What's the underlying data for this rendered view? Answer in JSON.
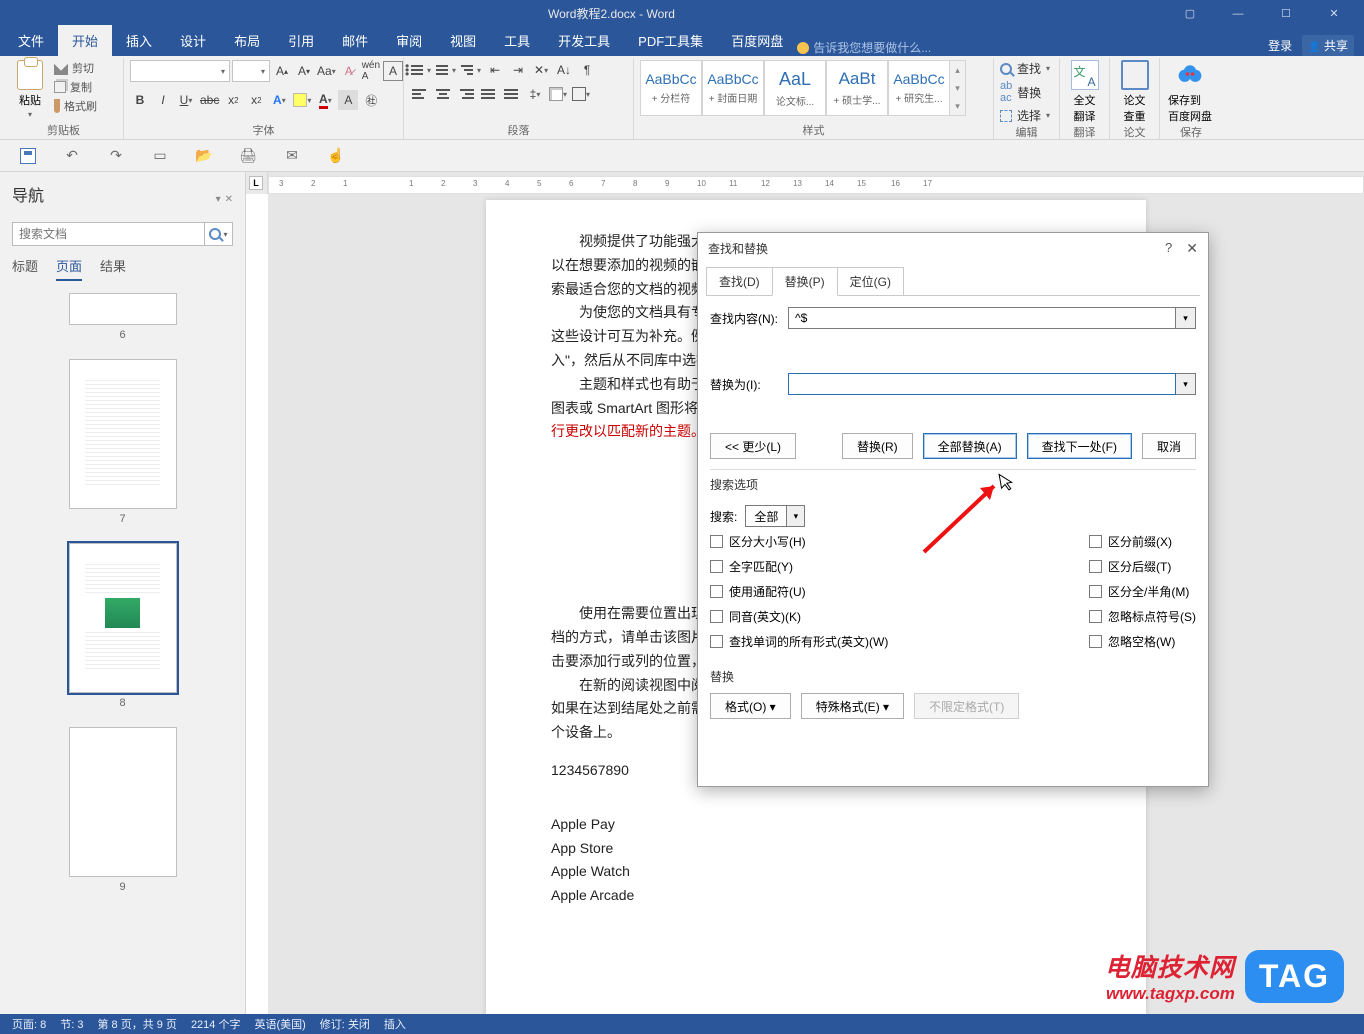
{
  "window": {
    "title": "Word教程2.docx - Word",
    "login": "登录",
    "share": "共享"
  },
  "tabs": {
    "file": "文件",
    "home": "开始",
    "insert": "插入",
    "design": "设计",
    "layout": "布局",
    "references": "引用",
    "mailings": "邮件",
    "review": "审阅",
    "view": "视图",
    "tools": "工具",
    "dev": "开发工具",
    "pdf": "PDF工具集",
    "baidu": "百度网盘",
    "tellme_placeholder": "告诉我您想要做什么..."
  },
  "ribbon": {
    "clipboard": {
      "paste": "粘贴",
      "cut": "剪切",
      "copy": "复制",
      "format_painter": "格式刷",
      "group": "剪贴板"
    },
    "font": {
      "group": "字体"
    },
    "paragraph": {
      "group": "段落"
    },
    "styles": {
      "items": [
        {
          "preview": "AaBbCc",
          "name": "+ 分栏符"
        },
        {
          "preview": "AaBbCc",
          "name": "+ 封面日期"
        },
        {
          "preview": "AaL",
          "name": "论文标..."
        },
        {
          "preview": "AaBt",
          "name": "+ 硕士学..."
        },
        {
          "preview": "AaBbCc",
          "name": "+ 研究生..."
        }
      ],
      "group": "样式"
    },
    "editing": {
      "find": "查找",
      "replace": "替换",
      "select": "选择",
      "group": "编辑"
    },
    "translate": {
      "l1": "全文",
      "l2": "翻译",
      "group": "翻译"
    },
    "thesis": {
      "l1": "论文",
      "l2": "查重",
      "group": "论文"
    },
    "baidu": {
      "l1": "保存到",
      "l2": "百度网盘",
      "group": "保存"
    }
  },
  "nav": {
    "title": "导航",
    "search_placeholder": "搜索文档",
    "tabs": {
      "headings": "标题",
      "pages": "页面",
      "results": "结果"
    },
    "pages": [
      "6",
      "7",
      "8",
      "9"
    ]
  },
  "doc": {
    "p1": "视频提供了功能强大的方",
    "p1b": "以在想要添加的视频的嵌入代",
    "p1c": "索最适合您的文档的视频。",
    "p2": "为使您的文档具有专业外",
    "p2b": "这些设计可互为补充。例如，",
    "p2c": "入\"，然后从不同库中选择所",
    "p3": "主题和样式也有助于文档",
    "p3b": "图表或 SmartArt 图形将会更",
    "p3c": "行更改以匹配新的主题。",
    "p4": "使用在需要位置出现的新",
    "p4b": "档的方式，请单击该图片，图",
    "p4c": "击要添加行或列的位置，然后",
    "p5": "在新的阅读视图中阅读更",
    "p5b": "如果在达到结尾处之前需要停",
    "p5c": "个设备上。",
    "num": "1234567890",
    "a1": "Apple Pay",
    "a2": "App Store",
    "a3": "Apple Watch",
    "a4": "Apple Arcade"
  },
  "dialog": {
    "title": "查找和替换",
    "tabs": {
      "find": "查找(D)",
      "replace": "替换(P)",
      "goto": "定位(G)"
    },
    "find_label": "查找内容(N):",
    "find_value": "^$",
    "replace_label": "替换为(I):",
    "replace_value": "",
    "btn_less": "<< 更少(L)",
    "btn_replace": "替换(R)",
    "btn_replace_all": "全部替换(A)",
    "btn_find_next": "查找下一处(F)",
    "btn_cancel": "取消",
    "section_opts": "搜索选项",
    "search_label": "搜索:",
    "search_value": "全部",
    "opts_left": [
      "区分大小写(H)",
      "全字匹配(Y)",
      "使用通配符(U)",
      "同音(英文)(K)",
      "查找单词的所有形式(英文)(W)"
    ],
    "opts_right": [
      "区分前缀(X)",
      "区分后缀(T)",
      "区分全/半角(M)",
      "忽略标点符号(S)",
      "忽略空格(W)"
    ],
    "section_replace": "替换",
    "btn_format": "格式(O) ▾",
    "btn_special": "特殊格式(E) ▾",
    "btn_noformat": "不限定格式(T)"
  },
  "status": {
    "page": "页面: 8",
    "sections": "节: 3",
    "page_of": "第 8 页，共 9 页",
    "words": "2214 个字",
    "lang": "英语(美国)",
    "track": "修订: 关闭",
    "insert": "插入"
  },
  "watermark": {
    "zh": "电脑技术网",
    "url": "www.tagxp.com",
    "tag": "TAG"
  }
}
